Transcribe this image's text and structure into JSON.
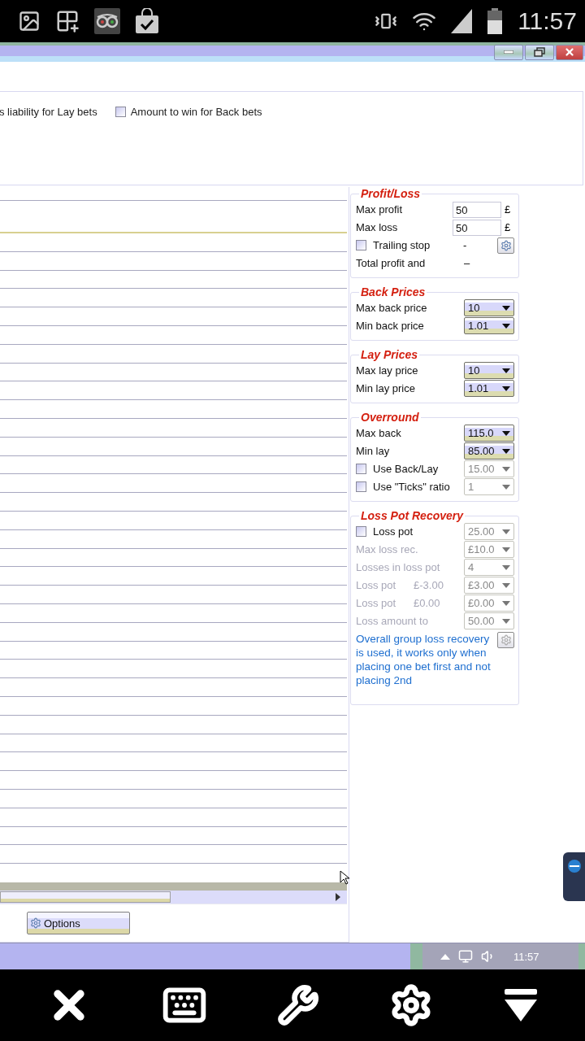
{
  "status_bar": {
    "time": "11:57"
  },
  "options_panel": {
    "items": [
      {
        "label": "s liability for Lay bets"
      },
      {
        "label": "Amount to win for Back bets",
        "checked": false
      }
    ]
  },
  "profit_loss": {
    "title": "Profit/Loss",
    "fields": [
      {
        "label": "Max profit",
        "value": "50",
        "unit": "£"
      },
      {
        "label": "Max loss",
        "value": "50",
        "unit": "£"
      }
    ],
    "trailing_stop": {
      "label": "Trailing stop",
      "checked": false,
      "value": "-"
    },
    "total": {
      "label": "Total profit and",
      "value": "–"
    }
  },
  "groups": [
    {
      "title": "Back Prices",
      "rows": [
        {
          "kind": "select",
          "label": "Max back price",
          "value": "10",
          "disabled": false
        },
        {
          "kind": "select",
          "label": "Min back price",
          "value": "1.01",
          "disabled": false
        }
      ]
    },
    {
      "title": "Lay Prices",
      "rows": [
        {
          "kind": "select",
          "label": "Max lay price",
          "value": "10",
          "disabled": false
        },
        {
          "kind": "select",
          "label": "Min lay price",
          "value": "1.01",
          "disabled": false
        }
      ]
    },
    {
      "title": "Overround",
      "rows": [
        {
          "kind": "select",
          "label": "Max back",
          "value": "115.0",
          "disabled": false
        },
        {
          "kind": "select",
          "label": "Min lay",
          "value": "85.00",
          "disabled": false
        },
        {
          "kind": "check",
          "label": "Use Back/Lay",
          "value": "15.00",
          "checked": false,
          "disabled": false
        },
        {
          "kind": "check",
          "label": "Use \"Ticks\" ratio",
          "value": "1",
          "checked": false,
          "disabled": false
        }
      ]
    },
    {
      "title": "Loss Pot Recovery",
      "rows": [
        {
          "kind": "check",
          "label": "Loss pot",
          "value": "25.00",
          "checked": false,
          "disabled": false
        },
        {
          "kind": "select",
          "label": "Max loss rec.",
          "value": "£10.0",
          "disabled": true
        },
        {
          "kind": "select",
          "label": "Losses in loss pot",
          "value": "4",
          "disabled": true
        },
        {
          "kind": "select",
          "label": "Loss pot",
          "note": "£-3.00",
          "value": "£3.00",
          "disabled": true
        },
        {
          "kind": "select",
          "label": "Loss pot",
          "note": "£0.00",
          "value": "£0.00",
          "disabled": true
        },
        {
          "kind": "select",
          "label": "Loss amount to",
          "value": "50.00",
          "disabled": true
        }
      ],
      "note": "Overall group loss recovery is used, it works only when placing one bet first and not placing 2nd"
    }
  ],
  "options_button": {
    "label": "Options"
  },
  "taskbar": {
    "time": "11:57"
  }
}
